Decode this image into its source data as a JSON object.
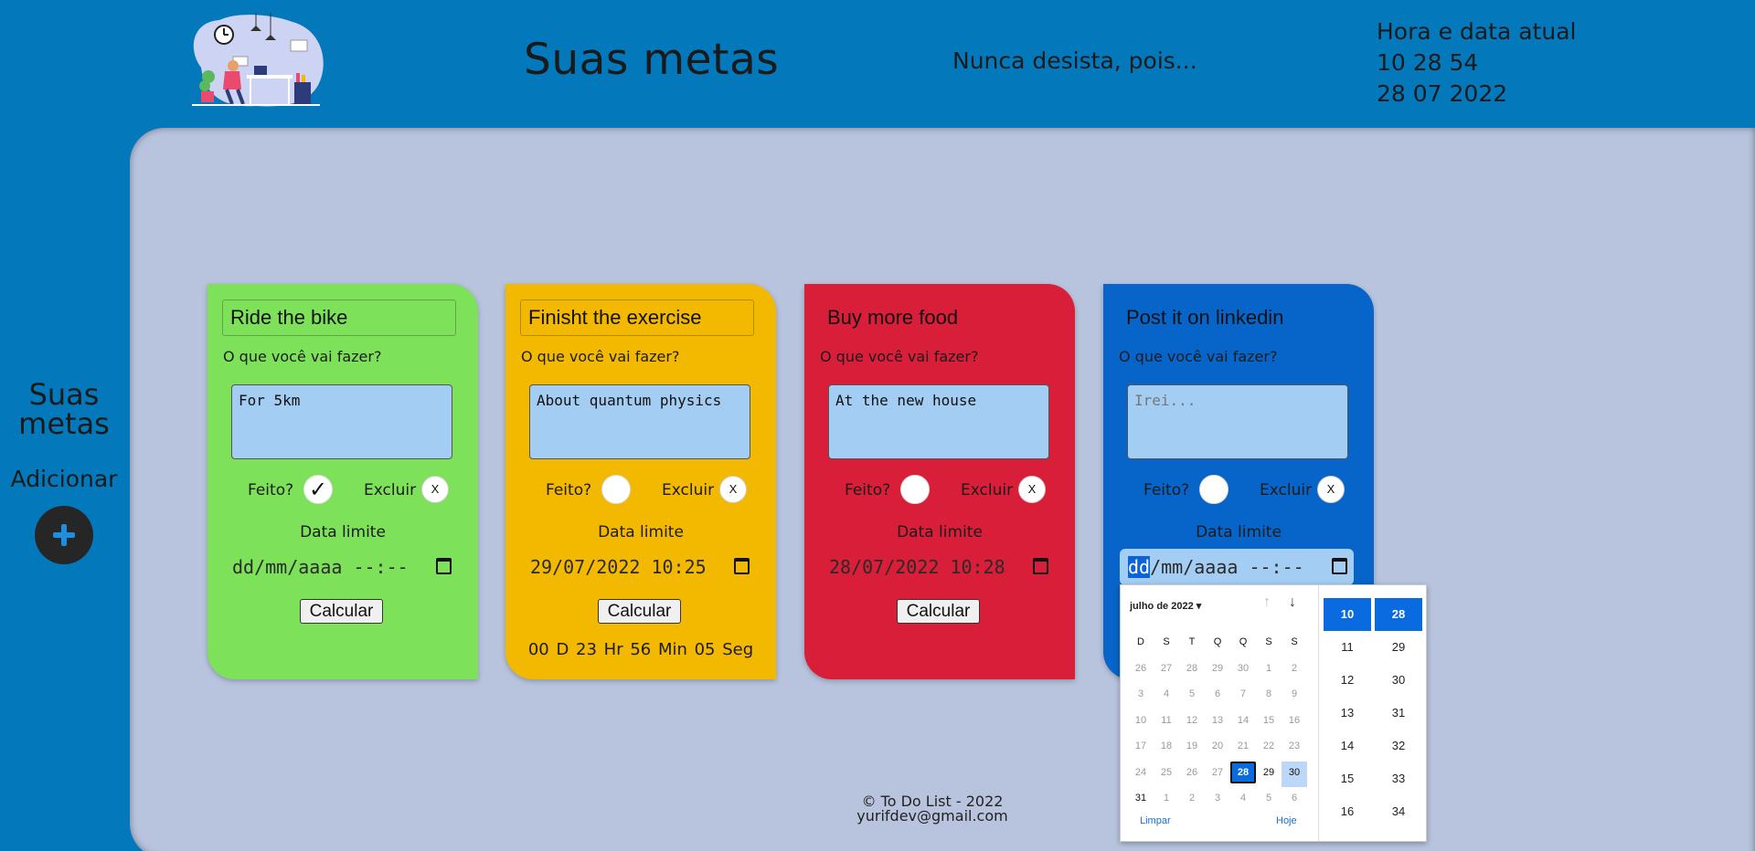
{
  "header": {
    "title": "Suas metas",
    "tagline": "Nunca desista, pois...",
    "clock_label": "Hora e data atual",
    "clock_time": "10 28 54",
    "clock_date": "28 07 2022"
  },
  "sidebar": {
    "title": "Suas metas",
    "add_label": "Adicionar",
    "add_icon": "plus-icon"
  },
  "labels": {
    "question": "O que você vai fazer?",
    "done": "Feito?",
    "delete": "Excluir",
    "delete_symbol": "X",
    "deadline": "Data limite",
    "calculate": "Calcular",
    "textarea_placeholder": "Irei..."
  },
  "cards": [
    {
      "title": "Ride the bike",
      "description": "For 5km",
      "done": true,
      "done_mark": "✓",
      "deadline": "dd/mm/aaaa --:--",
      "color": "#7de15a"
    },
    {
      "title": "Finisht the exercise",
      "description": "About quantum physics",
      "done": false,
      "deadline": "29/07/2022 10:25",
      "countdown": "00 D  23 Hr  56 Min  05 Seg",
      "color": "#f3b800"
    },
    {
      "title": "Buy more food",
      "description": "At the new house",
      "done": false,
      "deadline": "28/07/2022 10:28",
      "color": "#d81e38"
    },
    {
      "title": "Post it on linkedin",
      "description": "",
      "done": false,
      "deadline_selected": "dd",
      "deadline_rest": "/mm/aaaa --:--",
      "color": "#0764c9"
    }
  ],
  "footer": {
    "copyright": "© To Do List - 2022",
    "email": "yurifdev@gmail.com"
  },
  "date_picker": {
    "month_label": "julho de 2022 ▾",
    "weekdays": [
      "D",
      "S",
      "T",
      "Q",
      "Q",
      "S",
      "S"
    ],
    "weeks": [
      [
        "26",
        "27",
        "28",
        "29",
        "30",
        "1",
        "2"
      ],
      [
        "3",
        "4",
        "5",
        "6",
        "7",
        "8",
        "9"
      ],
      [
        "10",
        "11",
        "12",
        "13",
        "14",
        "15",
        "16"
      ],
      [
        "17",
        "18",
        "19",
        "20",
        "21",
        "22",
        "23"
      ],
      [
        "24",
        "25",
        "26",
        "27",
        "28",
        "29",
        "30"
      ],
      [
        "31",
        "1",
        "2",
        "3",
        "4",
        "5",
        "6"
      ]
    ],
    "selected_day": "28",
    "clear_label": "Limpar",
    "today_label": "Hoje",
    "hours": [
      "10",
      "11",
      "12",
      "13",
      "14",
      "15",
      "16"
    ],
    "minutes": [
      "28",
      "29",
      "30",
      "31",
      "32",
      "33",
      "34"
    ]
  },
  "colors": {
    "header_bg": "#0379bc",
    "main_bg": "#b8c4de",
    "accent": "#0a6ae0"
  }
}
